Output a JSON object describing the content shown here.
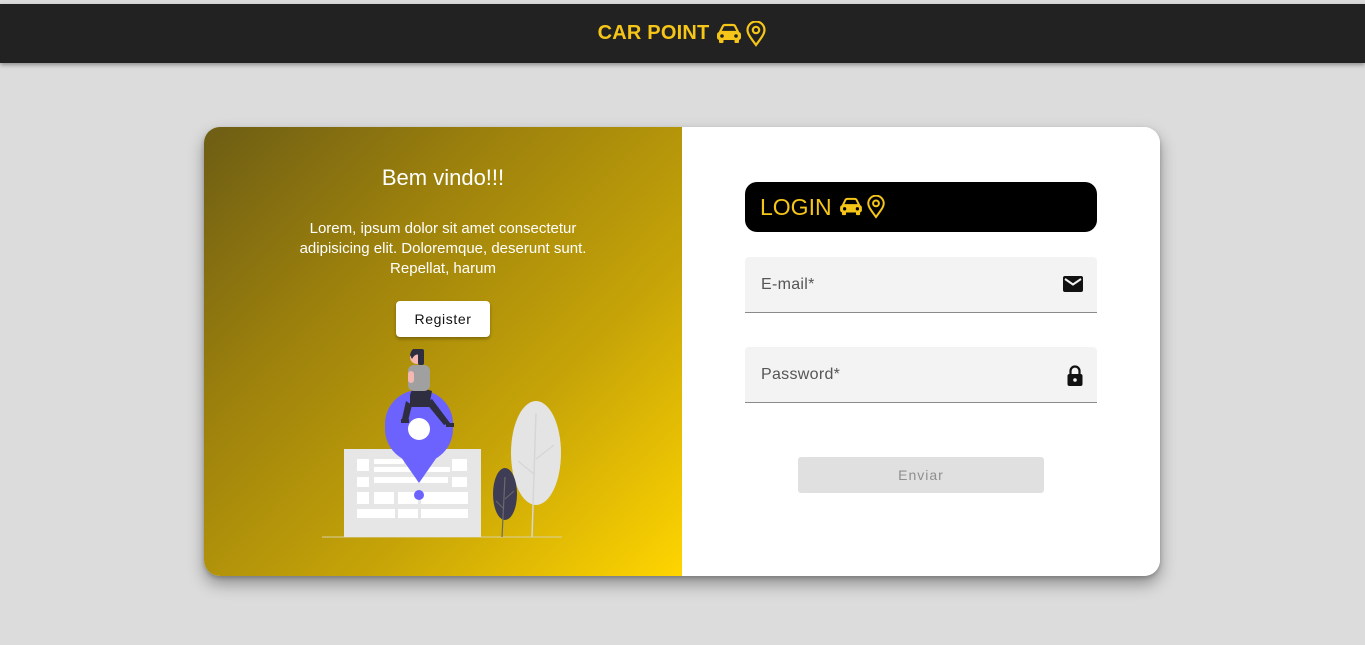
{
  "header": {
    "brand": "CAR POINT",
    "icons": [
      "car-icon",
      "map-pin-icon"
    ]
  },
  "welcome_panel": {
    "title": "Bem vindo!!!",
    "text": "Lorem, ipsum dolor sit amet consectetur adipisicing elit. Doloremque, deserunt sunt. Repellat, harum",
    "register_label": "Register"
  },
  "login_panel": {
    "title": "LOGIN",
    "icons": [
      "car-icon",
      "map-pin-icon"
    ],
    "email": {
      "placeholder": "E-mail*",
      "value": "",
      "icon": "mail-icon"
    },
    "password": {
      "placeholder": "Password*",
      "value": "",
      "icon": "lock-icon"
    },
    "submit_label": "Enviar"
  },
  "colors": {
    "accent": "#f5c518",
    "topbar": "#222222",
    "page_background": "#dcdcdc",
    "gradient_start": "#6d5d14",
    "gradient_end": "#ffd500",
    "illustration_primary": "#6c63ff"
  }
}
